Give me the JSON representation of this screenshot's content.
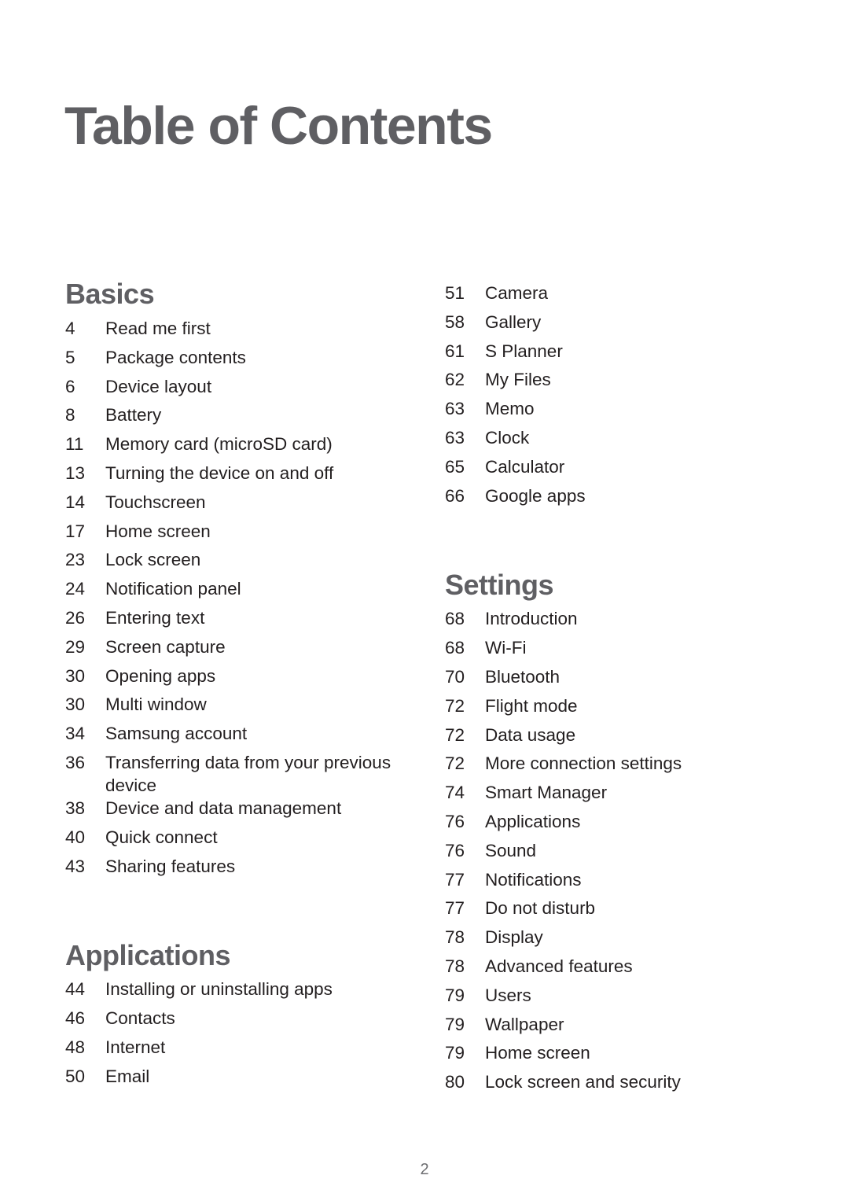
{
  "title": "Table of Contents",
  "sections": {
    "basics": {
      "heading": "Basics",
      "items": [
        {
          "page": "4",
          "label": "Read me first"
        },
        {
          "page": "5",
          "label": "Package contents"
        },
        {
          "page": "6",
          "label": "Device layout"
        },
        {
          "page": "8",
          "label": "Battery"
        },
        {
          "page": "11",
          "label": "Memory card (microSD card)"
        },
        {
          "page": "13",
          "label": "Turning the device on and off"
        },
        {
          "page": "14",
          "label": "Touchscreen"
        },
        {
          "page": "17",
          "label": "Home screen"
        },
        {
          "page": "23",
          "label": "Lock screen"
        },
        {
          "page": "24",
          "label": "Notification panel"
        },
        {
          "page": "26",
          "label": "Entering text"
        },
        {
          "page": "29",
          "label": "Screen capture"
        },
        {
          "page": "30",
          "label": "Opening apps"
        },
        {
          "page": "30",
          "label": "Multi window"
        },
        {
          "page": "34",
          "label": "Samsung account"
        },
        {
          "page": "36",
          "label": "Transferring data from your previous device"
        },
        {
          "page": "38",
          "label": "Device and data management"
        },
        {
          "page": "40",
          "label": "Quick connect"
        },
        {
          "page": "43",
          "label": "Sharing features"
        }
      ]
    },
    "applications": {
      "heading": "Applications",
      "items": [
        {
          "page": "44",
          "label": "Installing or uninstalling apps"
        },
        {
          "page": "46",
          "label": "Contacts"
        },
        {
          "page": "48",
          "label": "Internet"
        },
        {
          "page": "50",
          "label": "Email"
        },
        {
          "page": "51",
          "label": "Camera"
        },
        {
          "page": "58",
          "label": "Gallery"
        },
        {
          "page": "61",
          "label": "S Planner"
        },
        {
          "page": "62",
          "label": "My Files"
        },
        {
          "page": "63",
          "label": "Memo"
        },
        {
          "page": "63",
          "label": "Clock"
        },
        {
          "page": "65",
          "label": "Calculator"
        },
        {
          "page": "66",
          "label": "Google apps"
        }
      ]
    },
    "settings": {
      "heading": "Settings",
      "items": [
        {
          "page": "68",
          "label": "Introduction"
        },
        {
          "page": "68",
          "label": "Wi-Fi"
        },
        {
          "page": "70",
          "label": "Bluetooth"
        },
        {
          "page": "72",
          "label": "Flight mode"
        },
        {
          "page": "72",
          "label": "Data usage"
        },
        {
          "page": "72",
          "label": "More connection settings"
        },
        {
          "page": "74",
          "label": "Smart Manager"
        },
        {
          "page": "76",
          "label": "Applications"
        },
        {
          "page": "76",
          "label": "Sound"
        },
        {
          "page": "77",
          "label": "Notifications"
        },
        {
          "page": "77",
          "label": "Do not disturb"
        },
        {
          "page": "78",
          "label": "Display"
        },
        {
          "page": "78",
          "label": "Advanced features"
        },
        {
          "page": "79",
          "label": "Users"
        },
        {
          "page": "79",
          "label": "Wallpaper"
        },
        {
          "page": "79",
          "label": "Home screen"
        },
        {
          "page": "80",
          "label": "Lock screen and security"
        }
      ]
    }
  },
  "page_number": "2",
  "colors": {
    "heading": "#5f5f63",
    "body_text": "#231f20",
    "page_number": "#6d6e71"
  }
}
